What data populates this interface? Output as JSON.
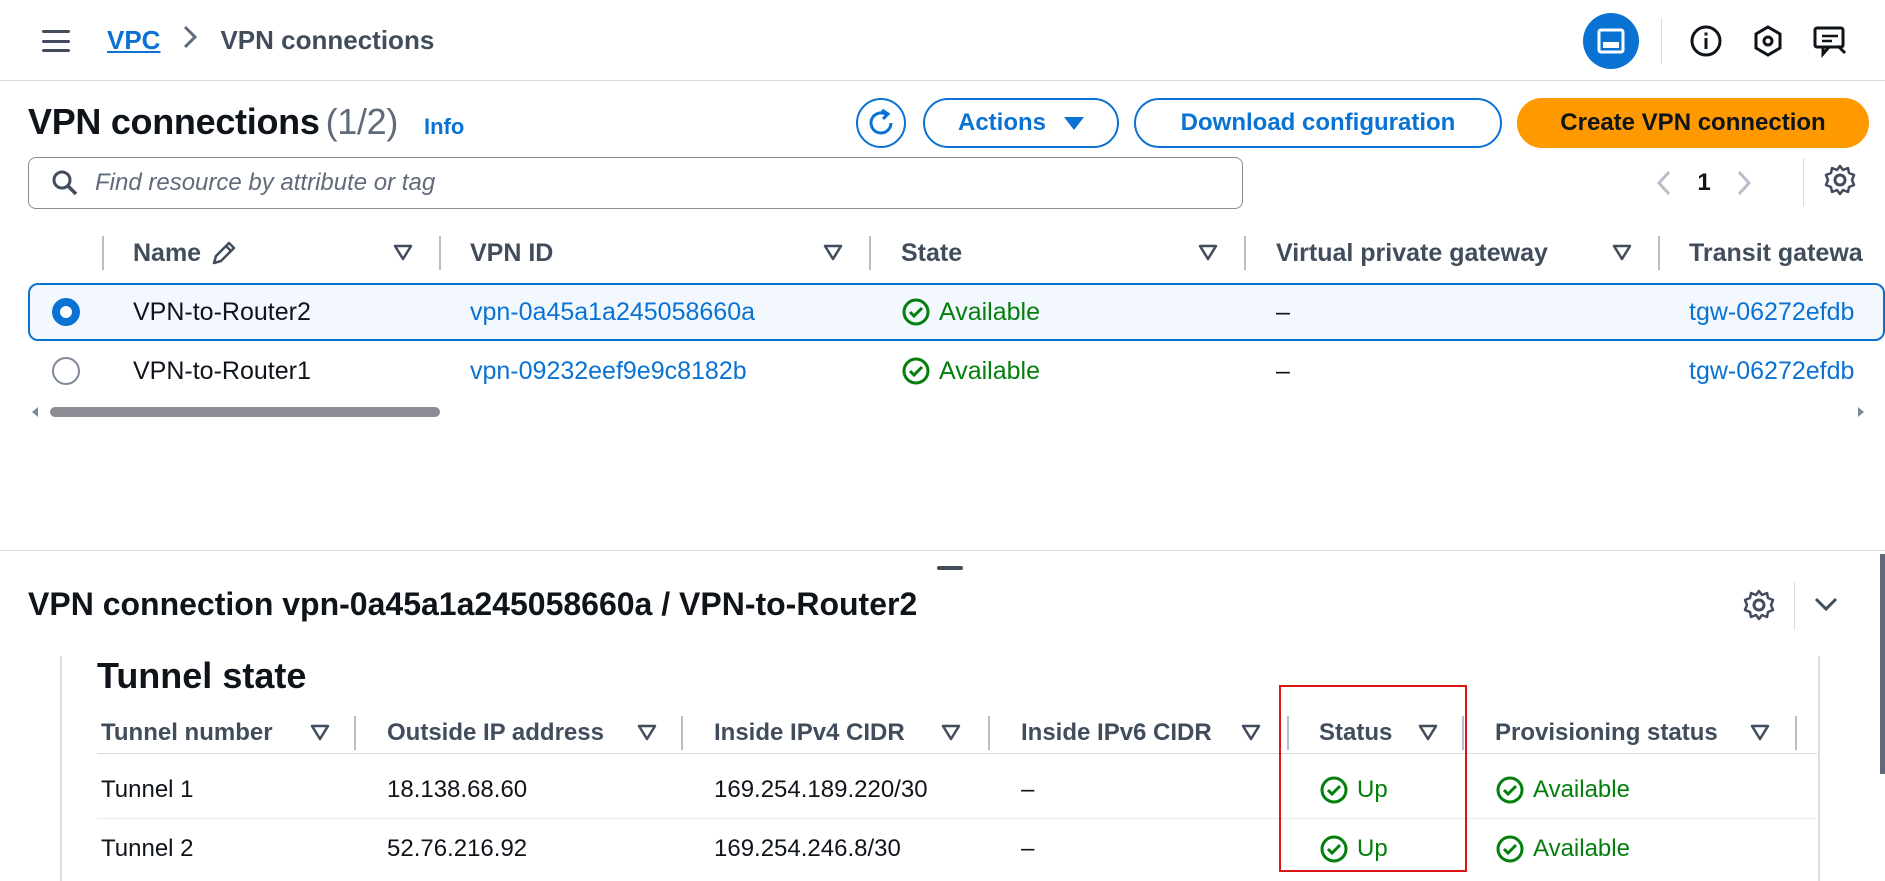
{
  "breadcrumb": {
    "root": "VPC",
    "current": "VPN connections"
  },
  "header": {
    "title": "VPN connections",
    "count": "(1/2)",
    "info": "Info",
    "actions_label": "Actions",
    "download_label": "Download configuration",
    "create_label": "Create VPN connection"
  },
  "search": {
    "placeholder": "Find resource by attribute or tag"
  },
  "pagination": {
    "page": "1"
  },
  "table": {
    "columns": [
      "Name",
      "VPN ID",
      "State",
      "Virtual private gateway",
      "Transit gatewa"
    ],
    "rows": [
      {
        "name": "VPN-to-Router2",
        "vpn_id": "vpn-0a45a1a245058660a",
        "state": "Available",
        "vgw": "–",
        "tgw": "tgw-06272efdb",
        "selected": true
      },
      {
        "name": "VPN-to-Router1",
        "vpn_id": "vpn-09232eef9e9c8182b",
        "state": "Available",
        "vgw": "–",
        "tgw": "tgw-06272efdb",
        "selected": false
      }
    ]
  },
  "detail": {
    "title": "VPN connection vpn-0a45a1a245058660a / VPN-to-Router2",
    "section_title": "Tunnel state",
    "columns": [
      "Tunnel number",
      "Outside IP address",
      "Inside IPv4 CIDR",
      "Inside IPv6 CIDR",
      "Status",
      "Provisioning status"
    ],
    "rows": [
      {
        "tunnel": "Tunnel 1",
        "outside_ip": "18.138.68.60",
        "ipv4": "169.254.189.220/30",
        "ipv6": "–",
        "status": "Up",
        "provisioning": "Available"
      },
      {
        "tunnel": "Tunnel 2",
        "outside_ip": "52.76.216.92",
        "ipv4": "169.254.246.8/30",
        "ipv6": "–",
        "status": "Up",
        "provisioning": "Available"
      }
    ]
  },
  "colors": {
    "link": "#0972d3",
    "primary": "#ff9900",
    "success": "#037f0c",
    "highlight": "#d91515"
  },
  "icons": [
    "menu-icon",
    "chevron-right-icon",
    "panel-icon",
    "info-icon",
    "hexagon-icon",
    "feedback-icon",
    "refresh-icon",
    "caret-down-icon",
    "search-icon",
    "chevron-left-icon",
    "gear-icon",
    "pencil-icon",
    "sort-icon",
    "check-circle-icon",
    "chevron-down-icon"
  ]
}
